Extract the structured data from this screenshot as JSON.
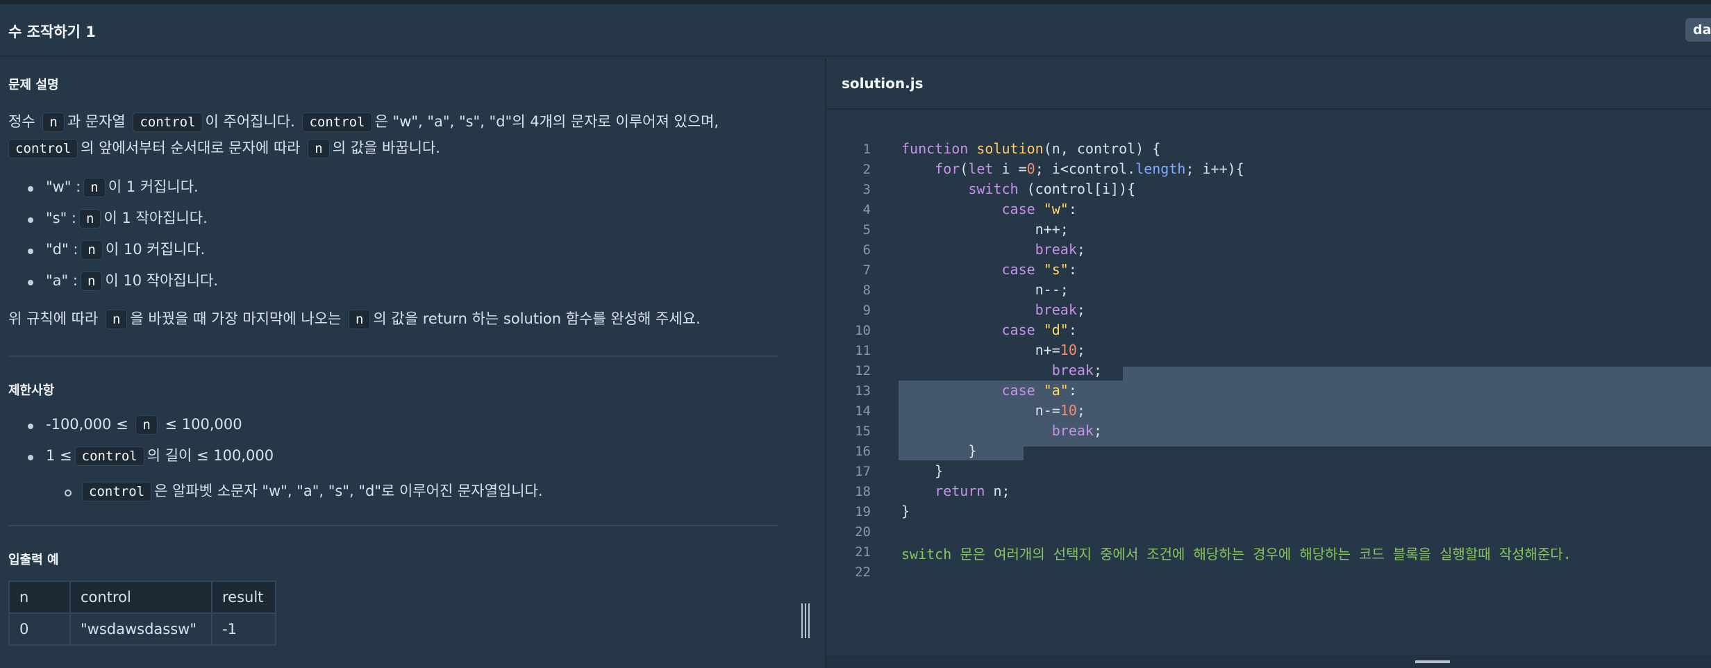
{
  "header": {
    "title": "수 조작하기 1",
    "user": "dan"
  },
  "editor": {
    "filename": "solution.js",
    "lines": [
      {
        "n": "1"
      },
      {
        "n": "2"
      },
      {
        "n": "3"
      },
      {
        "n": "4"
      },
      {
        "n": "5"
      },
      {
        "n": "6"
      },
      {
        "n": "7"
      },
      {
        "n": "8"
      },
      {
        "n": "9"
      },
      {
        "n": "10"
      },
      {
        "n": "11"
      },
      {
        "n": "12"
      },
      {
        "n": "13"
      },
      {
        "n": "14"
      },
      {
        "n": "15"
      },
      {
        "n": "16"
      },
      {
        "n": "17"
      },
      {
        "n": "18"
      },
      {
        "n": "19"
      },
      {
        "n": "20"
      },
      {
        "n": "21"
      },
      {
        "n": "22"
      }
    ],
    "code": {
      "l1": {
        "kw": "function",
        "fn": "solution",
        "rest": "(n, control) {"
      },
      "l2": {
        "kw": "for",
        "rest1": "(",
        "kw2": "let",
        "rest2": " i =",
        "num": "0",
        "rest3": "; i<control.",
        "prop": "length",
        "rest4": "; i++){"
      },
      "l3": {
        "kw": "switch",
        "rest": " (control[i]){"
      },
      "l4": {
        "kw": "case",
        "str": "\"w\"",
        "rest": ":"
      },
      "l5": {
        "rest": "n++;"
      },
      "l6": {
        "kw": "break",
        "rest": ";"
      },
      "l7": {
        "kw": "case",
        "str": "\"s\"",
        "rest": ":"
      },
      "l8": {
        "rest": "n--;"
      },
      "l9": {
        "kw": "break",
        "rest": ";"
      },
      "l10": {
        "kw": "case",
        "str": "\"d\"",
        "rest": ":"
      },
      "l11": {
        "rest": "n+=",
        "num": "10",
        "rest2": ";"
      },
      "l12": {
        "kw": "break",
        "rest": ";"
      },
      "l13": {
        "kw": "case",
        "str": "\"a\"",
        "rest": ":"
      },
      "l14": {
        "rest": "n-=",
        "num": "10",
        "rest2": ";"
      },
      "l15": {
        "kw": "break",
        "rest": ";"
      },
      "l16": {
        "rest": "}"
      },
      "l17": {
        "rest": "}"
      },
      "l18": {
        "kw": "return",
        "rest": " n;"
      },
      "l19": {
        "rest": "}"
      },
      "l21": {
        "kw": "switch",
        "comment": " 문은 여러개의 선택지 중에서 조건에 해당하는 경우에 해당하는 코드 블록을 실행할때 작성해준다."
      }
    }
  },
  "problem": {
    "section_title": "문제 설명",
    "line1": {
      "a": "정수",
      "code_n": "n",
      "b": "과 문자열",
      "code_control": "control",
      "c": "이 주어집니다.",
      "code_control2": "control",
      "d": "은 \"w\", \"a\", \"s\", \"d\"의 4개의 문자로 이루어져 있으며,"
    },
    "line2": {
      "code_control": "control",
      "a": "의 앞에서부터 순서대로 문자에 따라",
      "code_n": "n",
      "b": "의 값을 바꿉니다."
    },
    "rules": [
      {
        "key": "\"w\" :",
        "code": "n",
        "text": "이 1 커집니다."
      },
      {
        "key": "\"s\" :",
        "code": "n",
        "text": "이 1 작아집니다."
      },
      {
        "key": "\"d\" :",
        "code": "n",
        "text": "이 10 커집니다."
      },
      {
        "key": "\"a\" :",
        "code": "n",
        "text": "이 10 작아집니다."
      }
    ],
    "line3": {
      "a": "위 규칙에 따라",
      "code_n": "n",
      "b": "을 바꿨을 때 가장 마지막에 나오는",
      "code_n2": "n",
      "c": "의 값을 return 하는 solution 함수를 완성해 주세요."
    }
  },
  "constraints": {
    "section_title": "제한사항",
    "c1": {
      "a": "-100,000 ≤",
      "code": "n",
      "b": "≤ 100,000"
    },
    "c2": {
      "a": "1 ≤",
      "code": "control",
      "b": "의 길이 ≤ 100,000"
    },
    "c3": {
      "code": "control",
      "b": "은 알파벳 소문자 \"w\", \"a\", \"s\", \"d\"로 이루어진 문자열입니다."
    }
  },
  "examples": {
    "section_title": "입출력 예",
    "headers": [
      "n",
      "control",
      "result"
    ],
    "rows": [
      [
        "0",
        "\"wsdawsdassw\"",
        "-1"
      ]
    ]
  }
}
